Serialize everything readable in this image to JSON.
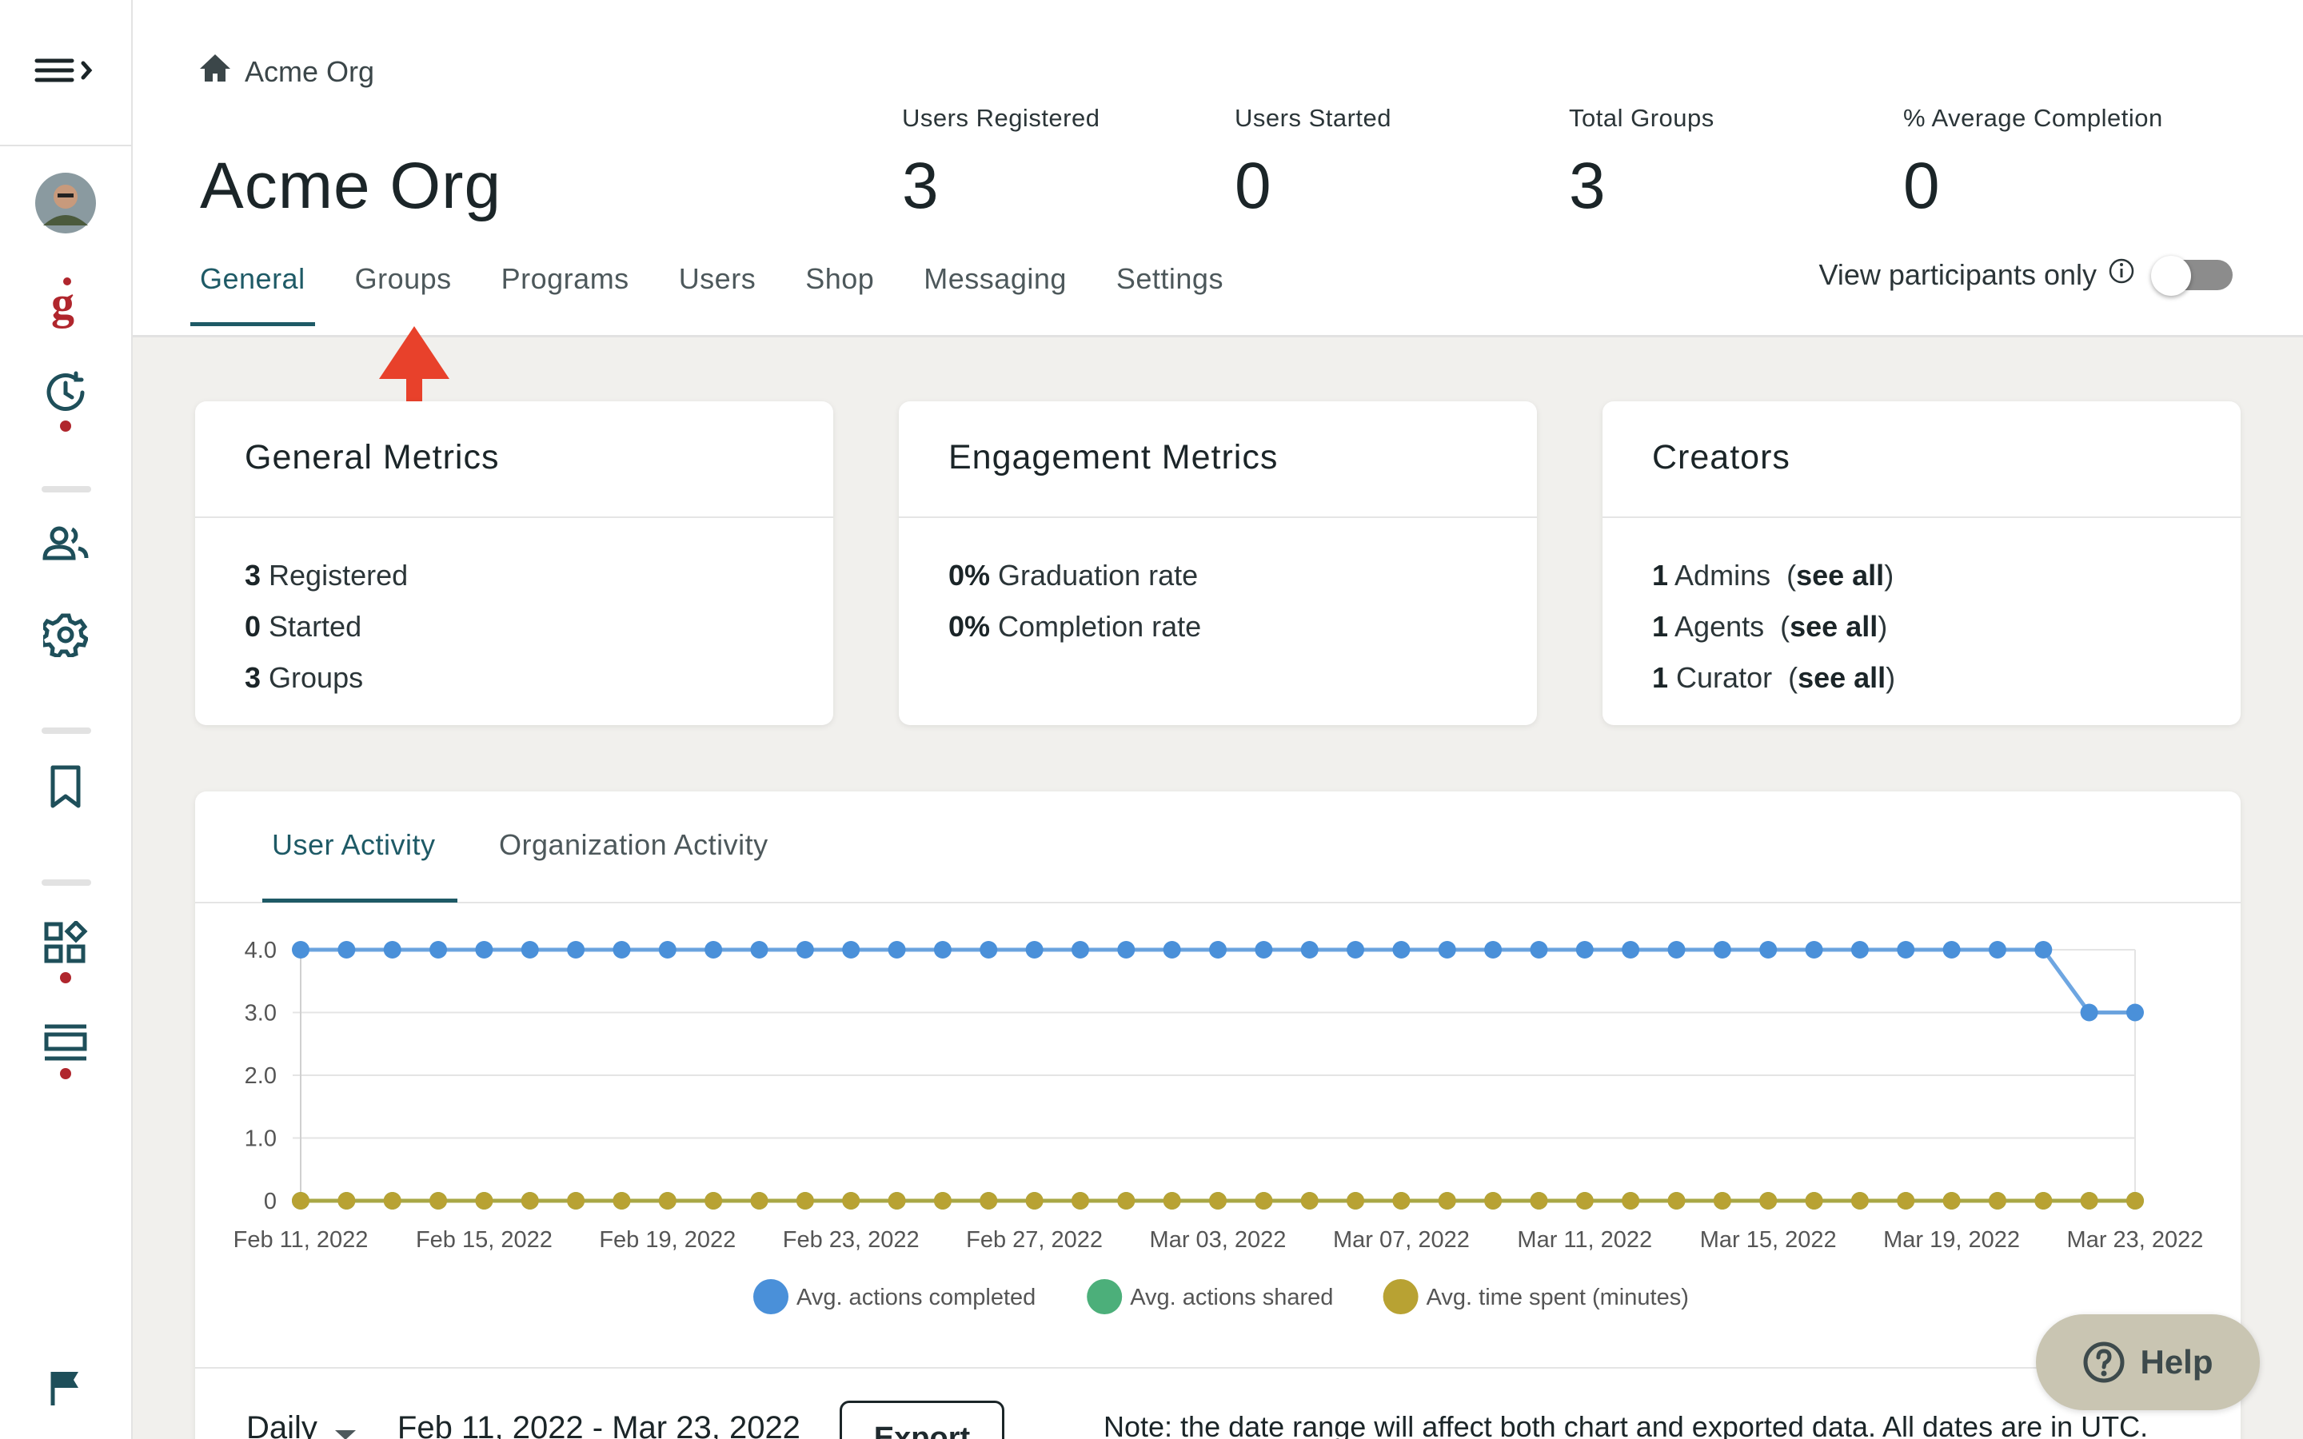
{
  "breadcrumb": {
    "label": "Acme Org"
  },
  "page": {
    "title": "Acme Org"
  },
  "stats": [
    {
      "label": "Users Registered",
      "value": "3"
    },
    {
      "label": "Users Started",
      "value": "0"
    },
    {
      "label": "Total Groups",
      "value": "3"
    },
    {
      "label": "% Average Completion",
      "value": "0"
    }
  ],
  "tabs": [
    "General",
    "Groups",
    "Programs",
    "Users",
    "Shop",
    "Messaging",
    "Settings"
  ],
  "active_tab": "General",
  "participants_toggle": {
    "label": "View participants only",
    "on": false
  },
  "cards": {
    "general": {
      "title": "General Metrics",
      "rows": [
        {
          "num": "3",
          "text": " Registered"
        },
        {
          "num": "0",
          "text": " Started"
        },
        {
          "num": "3",
          "text": " Groups"
        }
      ]
    },
    "engagement": {
      "title": "Engagement Metrics",
      "rows": [
        {
          "num": "0%",
          "text": " Graduation rate"
        },
        {
          "num": "0%",
          "text": " Completion rate"
        }
      ]
    },
    "creators": {
      "title": "Creators",
      "rows": [
        {
          "num": "1",
          "text": " Admins  (",
          "link": "see all",
          "end": ")"
        },
        {
          "num": "1",
          "text": " Agents  (",
          "link": "see all",
          "end": ")"
        },
        {
          "num": "1",
          "text": " Curator  (",
          "link": "see all",
          "end": ")"
        }
      ]
    }
  },
  "activity_tabs": [
    "User Activity",
    "Organization Activity"
  ],
  "chart_data": {
    "type": "line",
    "x": [
      "Feb 11, 2022",
      "Feb 12, 2022",
      "Feb 13, 2022",
      "Feb 14, 2022",
      "Feb 15, 2022",
      "Feb 16, 2022",
      "Feb 17, 2022",
      "Feb 18, 2022",
      "Feb 19, 2022",
      "Feb 20, 2022",
      "Feb 21, 2022",
      "Feb 22, 2022",
      "Feb 23, 2022",
      "Feb 24, 2022",
      "Feb 25, 2022",
      "Feb 26, 2022",
      "Feb 27, 2022",
      "Feb 28, 2022",
      "Mar 01, 2022",
      "Mar 02, 2022",
      "Mar 03, 2022",
      "Mar 04, 2022",
      "Mar 05, 2022",
      "Mar 06, 2022",
      "Mar 07, 2022",
      "Mar 08, 2022",
      "Mar 09, 2022",
      "Mar 10, 2022",
      "Mar 11, 2022",
      "Mar 12, 2022",
      "Mar 13, 2022",
      "Mar 14, 2022",
      "Mar 15, 2022",
      "Mar 16, 2022",
      "Mar 17, 2022",
      "Mar 18, 2022",
      "Mar 19, 2022",
      "Mar 20, 2022",
      "Mar 21, 2022",
      "Mar 22, 2022",
      "Mar 23, 2022"
    ],
    "xtick_labels": [
      "Feb 11, 2022",
      "Feb 15, 2022",
      "Feb 19, 2022",
      "Feb 23, 2022",
      "Feb 27, 2022",
      "Mar 03, 2022",
      "Mar 07, 2022",
      "Mar 11, 2022",
      "Mar 15, 2022",
      "Mar 19, 2022",
      "Mar 23, 2022"
    ],
    "ytick_labels": [
      "4.0",
      "3.0",
      "2.0",
      "1.0",
      "0"
    ],
    "ylim": [
      0,
      4
    ],
    "series": [
      {
        "name": "Avg. actions completed",
        "color": "#4a90d9",
        "values": [
          4,
          4,
          4,
          4,
          4,
          4,
          4,
          4,
          4,
          4,
          4,
          4,
          4,
          4,
          4,
          4,
          4,
          4,
          4,
          4,
          4,
          4,
          4,
          4,
          4,
          4,
          4,
          4,
          4,
          4,
          4,
          4,
          4,
          4,
          4,
          4,
          4,
          4,
          4,
          3,
          3
        ]
      },
      {
        "name": "Avg. actions shared",
        "color": "#4caf7a",
        "values": [
          0,
          0,
          0,
          0,
          0,
          0,
          0,
          0,
          0,
          0,
          0,
          0,
          0,
          0,
          0,
          0,
          0,
          0,
          0,
          0,
          0,
          0,
          0,
          0,
          0,
          0,
          0,
          0,
          0,
          0,
          0,
          0,
          0,
          0,
          0,
          0,
          0,
          0,
          0,
          0,
          0
        ]
      },
      {
        "name": "Avg. time spent (minutes)",
        "color": "#b8a233",
        "values": [
          0,
          0,
          0,
          0,
          0,
          0,
          0,
          0,
          0,
          0,
          0,
          0,
          0,
          0,
          0,
          0,
          0,
          0,
          0,
          0,
          0,
          0,
          0,
          0,
          0,
          0,
          0,
          0,
          0,
          0,
          0,
          0,
          0,
          0,
          0,
          0,
          0,
          0,
          0,
          0,
          0
        ]
      }
    ],
    "legend": "bottom",
    "grid": true
  },
  "controls": {
    "interval": "Daily",
    "date_range": "Feb 11, 2022 - Mar 23, 2022",
    "export_label": "Export",
    "note": "Note: the date range will affect both chart and exported data. All dates are in UTC."
  },
  "help": {
    "label": "Help"
  }
}
